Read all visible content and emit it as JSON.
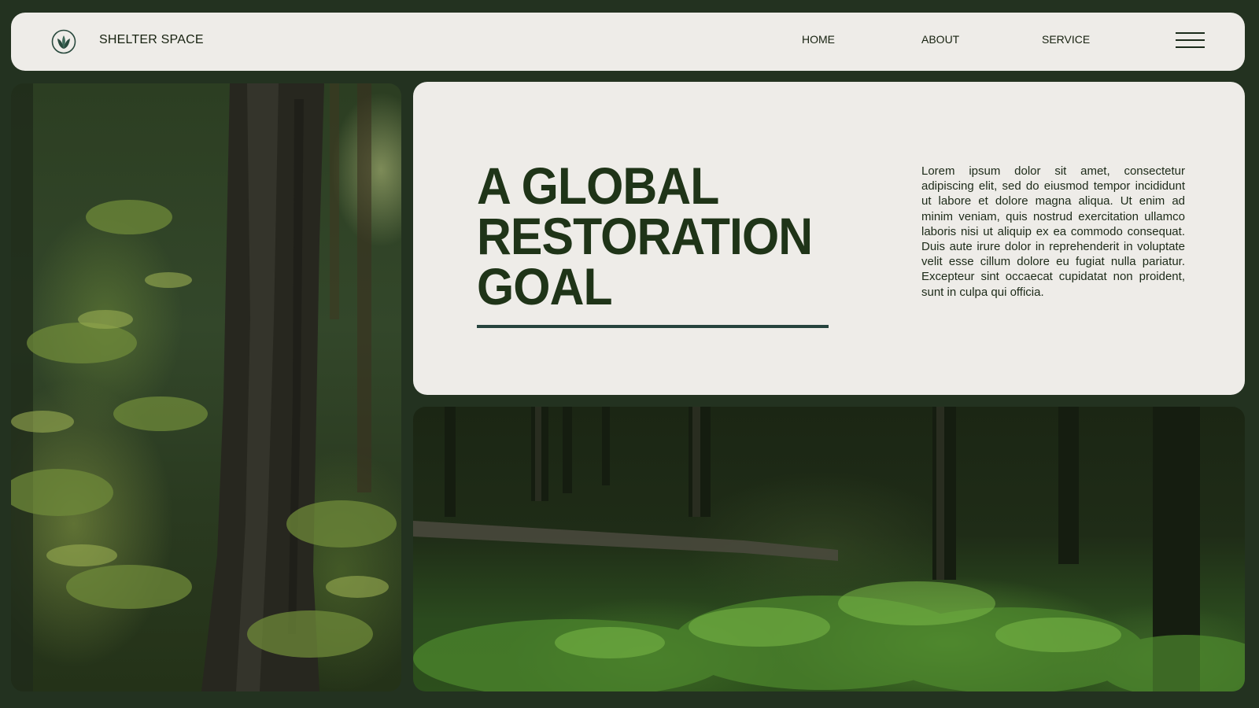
{
  "header": {
    "brand": "SHELTER SPACE",
    "logo_icon": "leaf-circle-icon",
    "nav": {
      "home": "HOME",
      "about": "ABOUT",
      "service": "SERVICE"
    },
    "menu_icon": "hamburger-menu-icon"
  },
  "hero": {
    "title_lines": [
      "A GLOBAL",
      "RESTORATION",
      "GOAL"
    ],
    "body": "Lorem ipsum dolor sit amet, consectetur adipiscing elit, sed do eiusmod tempor incididunt ut labore et dolore magna aliqua. Ut enim ad minim veniam, quis nostrud exercitation ullamco laboris nisi ut aliquip ex ea commodo consequat. Duis aute irure dolor in reprehenderit in voluptate velit esse cillum dolore eu fugiat nulla pariatur. Excepteur sint occaecat cupidatat non proident, sunt in culpa qui officia."
  },
  "colors": {
    "background": "#233220",
    "panel": "#eeece8",
    "title": "#1f3418",
    "underline": "#26433d"
  }
}
